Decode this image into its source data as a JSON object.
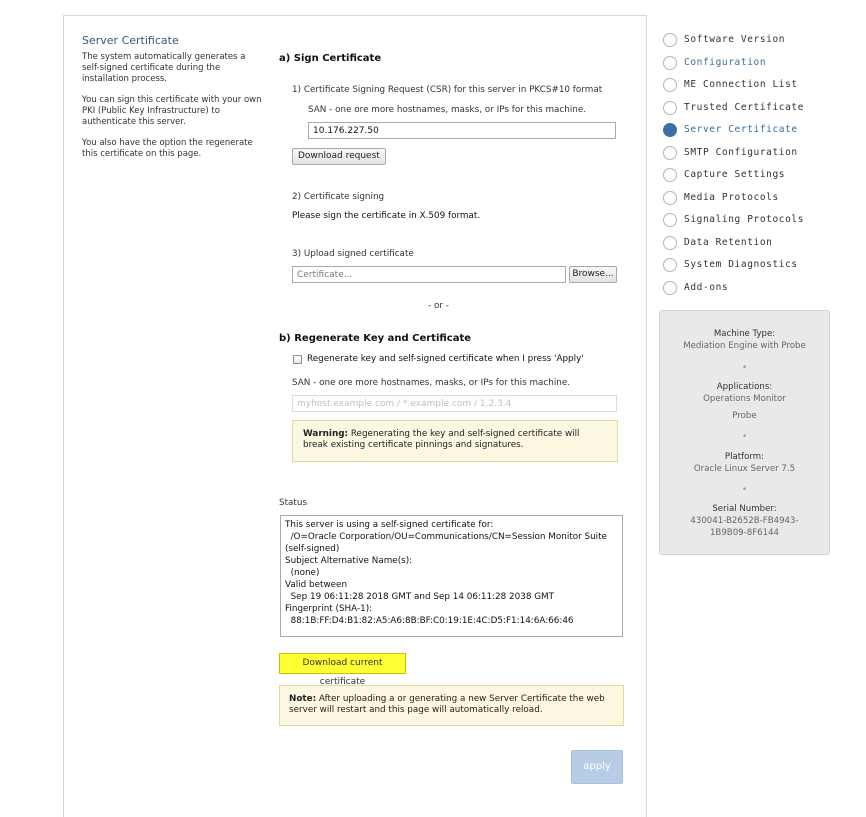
{
  "intro": {
    "title": "Server Certificate",
    "p1": "The system automatically generates a self-signed certificate during the installation process.",
    "p2": "You can sign this certificate with your own PKI (Public Key Infrastructure) to authenticate this server.",
    "p3": "You also have the option the regenerate this certificate on this page."
  },
  "sign": {
    "heading": "a) Sign Certificate",
    "csr_label": "1) Certificate Signing Request (CSR) for this server in PKCS#10 format",
    "san_label": "SAN - one ore more hostnames, masks, or IPs for this machine.",
    "san_value": "10.176.227.50",
    "download_request": "Download request",
    "signing_label": "2) Certificate signing",
    "signing_text": "Please sign the certificate in X.509 format.",
    "upload_label": "3) Upload signed certificate",
    "upload_placeholder": "Certificate...",
    "browse": "Browse...",
    "or": "- or -"
  },
  "regen": {
    "heading": "b) Regenerate Key and Certificate",
    "checkbox_label": "Regenerate key and self-signed certificate when I press 'Apply'",
    "checked": false,
    "san_label": "SAN - one ore more hostnames, masks, or IPs for this machine.",
    "san_placeholder": "myhost.example.com / *.example.com / 1.2.3.4",
    "warning_bold": "Warning:",
    "warning_text": " Regenerating the key and self-signed certificate will break existing certificate pinnings and signatures."
  },
  "status": {
    "label": "Status",
    "lines": [
      "This server is using a self-signed certificate for:",
      "  /O=Oracle Corporation/OU=Communications/CN=Session Monitor Suite",
      "(self-signed)",
      "Subject Alternative Name(s):",
      "  (none)",
      "Valid between",
      "  Sep 19 06:11:28 2018 GMT and Sep 14 06:11:28 2038 GMT",
      "Fingerprint (SHA-1):",
      "  88:1B:FF:D4:B1:82:A5:A6:8B:BF:C0:19:1E:4C:D5:F1:14:6A:66:46"
    ],
    "download_cert": "Download current certificate"
  },
  "note": {
    "bold": "Note:",
    "text": " After uploading a or generating a new Server Certificate the web server will restart and this page will automatically reload."
  },
  "apply_label": "apply",
  "wizard_steps": [
    {
      "label": "Software Version",
      "state": "done"
    },
    {
      "label": "Configuration",
      "state": "link"
    },
    {
      "label": "ME Connection List",
      "state": "done"
    },
    {
      "label": "Trusted Certificate",
      "state": "done"
    },
    {
      "label": "Server Certificate",
      "state": "active"
    },
    {
      "label": "SMTP Configuration",
      "state": "done"
    },
    {
      "label": "Capture Settings",
      "state": "done"
    },
    {
      "label": "Media Protocols",
      "state": "done"
    },
    {
      "label": "Signaling Protocols",
      "state": "done"
    },
    {
      "label": "Data Retention",
      "state": "done"
    },
    {
      "label": "System Diagnostics",
      "state": "done"
    },
    {
      "label": "Add-ons",
      "state": "done"
    }
  ],
  "info": {
    "machine_type_label": "Machine Type:",
    "machine_type": "Mediation Engine with Probe",
    "applications_label": "Applications:",
    "applications": [
      "Operations Monitor",
      "Probe"
    ],
    "platform_label": "Platform:",
    "platform": "Oracle Linux Server 7.5",
    "serial_label": "Serial Number:",
    "serial_1": "430041-B2652B-FB4943-",
    "serial_2": "1B9B09-8F6144",
    "separator": "•"
  },
  "colors": {
    "accent": "#3d6ea5",
    "highlight": "#ffff33",
    "warning_bg": "#fbf7e1",
    "apply_disabled": "#b7cde6"
  }
}
